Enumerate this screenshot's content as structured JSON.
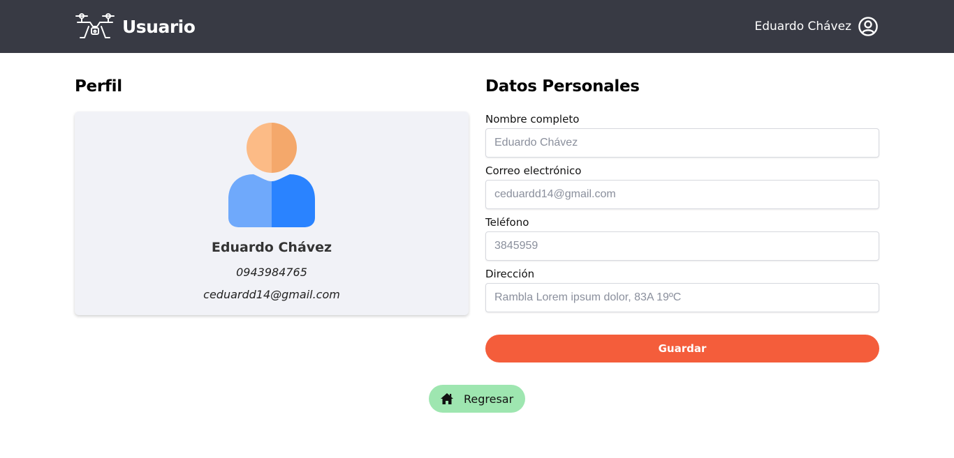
{
  "header": {
    "title": "Usuario",
    "logo_icon": "drone-icon",
    "user_name": "Eduardo Chávez",
    "user_icon": "user-circle-icon",
    "background": "#383a44"
  },
  "profile": {
    "section_title": "Perfil",
    "avatar_icon": "user-avatar-icon",
    "name": "Eduardo Chávez",
    "phone": "0943984765",
    "email": "ceduardd14@gmail.com"
  },
  "personal": {
    "section_title": "Datos Personales",
    "fields": [
      {
        "label": "Nombre completo",
        "placeholder": "Eduardo Chávez",
        "value": ""
      },
      {
        "label": "Correo electrónico",
        "placeholder": "ceduardd14@gmail.com",
        "value": ""
      },
      {
        "label": "Teléfono",
        "placeholder": "3845959",
        "value": ""
      },
      {
        "label": "Dirección",
        "placeholder": "Rambla Lorem ipsum dolor, 83A 19ºC",
        "value": ""
      }
    ],
    "save_label": "Guardar",
    "save_color": "#f45d3b"
  },
  "footer": {
    "back_label": "Regresar",
    "back_icon": "home-icon",
    "back_color": "#9ee6b0"
  }
}
